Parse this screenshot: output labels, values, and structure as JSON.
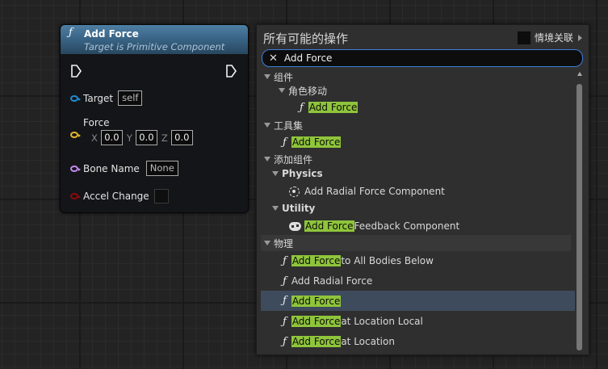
{
  "node": {
    "icon": "function-icon",
    "title": "Add Force",
    "subtitle": "Target is Primitive Component",
    "target_label": "Target",
    "target_value": "self",
    "force_label": "Force",
    "force_x_label": "X",
    "force_x": "0.0",
    "force_y_label": "Y",
    "force_y": "0.0",
    "force_z_label": "Z",
    "force_z": "0.0",
    "bone_label": "Bone Name",
    "bone_value": "None",
    "accel_label": "Accel Change",
    "pin_colors": {
      "target": "#1e8cd2",
      "force": "#e4b52f",
      "bone": "#c488ee",
      "accel": "#8c0a0a",
      "exec": "#f2f2f2"
    }
  },
  "menu": {
    "title": "所有可能的操作",
    "context_label": "情境关联",
    "search_value": "Add Force",
    "highlight_color": "#8fc53b",
    "items": [
      {
        "kind": "category",
        "label": "组件"
      },
      {
        "kind": "category",
        "label": "角色移动"
      },
      {
        "kind": "action",
        "icon": "function-icon",
        "match": "Add Force",
        "rest": ""
      },
      {
        "kind": "category",
        "label": "工具集"
      },
      {
        "kind": "action",
        "icon": "function-icon",
        "match": "Add Force",
        "rest": ""
      },
      {
        "kind": "category",
        "label": "添加组件"
      },
      {
        "kind": "category",
        "label": "Physics"
      },
      {
        "kind": "action",
        "icon": "radial-force-icon",
        "prefix": "Add Radial Force Component"
      },
      {
        "kind": "category",
        "label": "Utility"
      },
      {
        "kind": "action",
        "icon": "gamepad-icon",
        "match": "Add Force",
        "rest": " Feedback Component"
      },
      {
        "kind": "category",
        "label": "物理"
      },
      {
        "kind": "action",
        "icon": "function-icon",
        "match": "Add Force",
        "rest": " to All Bodies Below"
      },
      {
        "kind": "action",
        "icon": "function-icon",
        "prefix": "Add Radial Force"
      },
      {
        "kind": "action",
        "icon": "function-icon",
        "match": "Add Force",
        "rest": "",
        "selected": true
      },
      {
        "kind": "action",
        "icon": "function-icon",
        "match": "Add Force",
        "rest": " at Location Local"
      },
      {
        "kind": "action",
        "icon": "function-icon",
        "match": "Add Force",
        "rest": " at Location"
      }
    ]
  }
}
